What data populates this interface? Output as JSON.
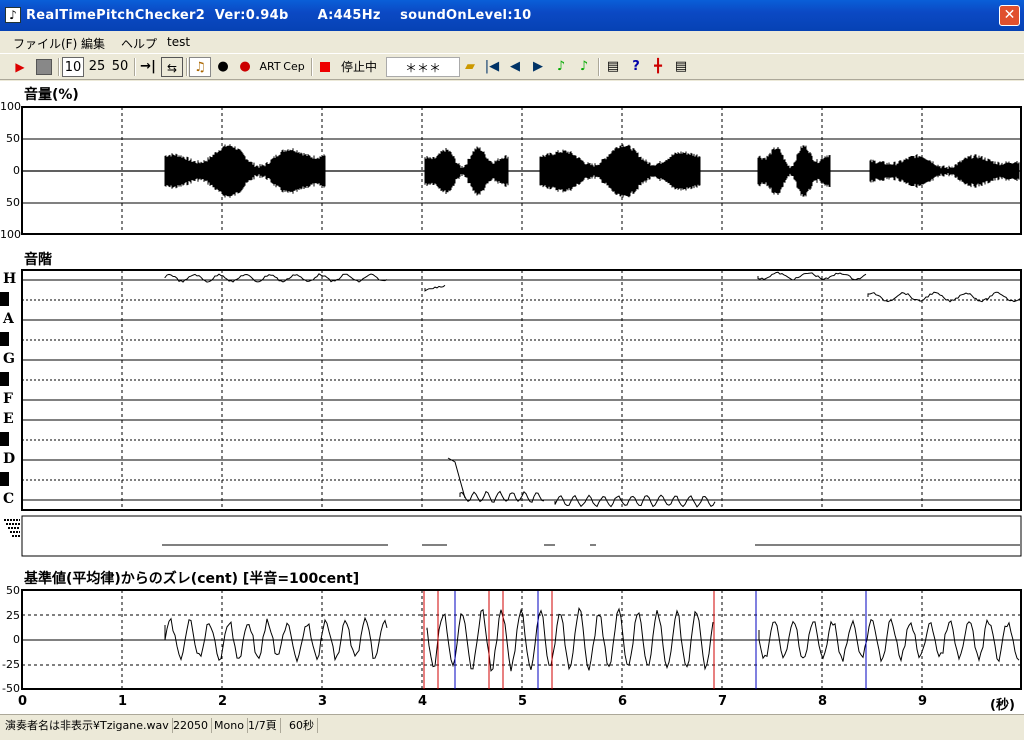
{
  "title": {
    "app": "RealTimePitchChecker2",
    "version": "Ver:0.94b",
    "a_freq": "A:445Hz",
    "sound_on_level": "soundOnLevel:10",
    "icon": "note-icon"
  },
  "menu": [
    "ファイル(F)",
    "編集",
    "ヘルプ",
    "test"
  ],
  "toolbar": {
    "speed_options": [
      "10",
      "25",
      "50"
    ],
    "art": "ART",
    "cep": "Cep",
    "status": "停止中",
    "display": "＊＊＊"
  },
  "volume_panel": {
    "title": "音量(%)",
    "y_labels": [
      "100",
      "50",
      "0",
      "50",
      "100"
    ]
  },
  "scale_panel": {
    "title": "音階",
    "notes": [
      "H",
      "A",
      "G",
      "F",
      "E",
      "D",
      "C"
    ]
  },
  "deviation_panel": {
    "title": "基準値(平均律)からのズレ(cent) [半音=100cent]",
    "y_labels": [
      "50",
      "25",
      "0",
      "-25",
      "-50"
    ]
  },
  "x_axis": {
    "labels": [
      "0",
      "1",
      "2",
      "3",
      "4",
      "5",
      "6",
      "7",
      "8",
      "9"
    ],
    "unit": "(秒)"
  },
  "status": [
    "演奏者名は非表示¥Tzigane.wav",
    "22050",
    "Mono",
    "1/7頁",
    "60秒"
  ],
  "colors": {
    "titlebar": "#0b49c4",
    "waveform": "#000000",
    "deviation_red": "#d00000",
    "deviation_blue": "#0000c0"
  }
}
